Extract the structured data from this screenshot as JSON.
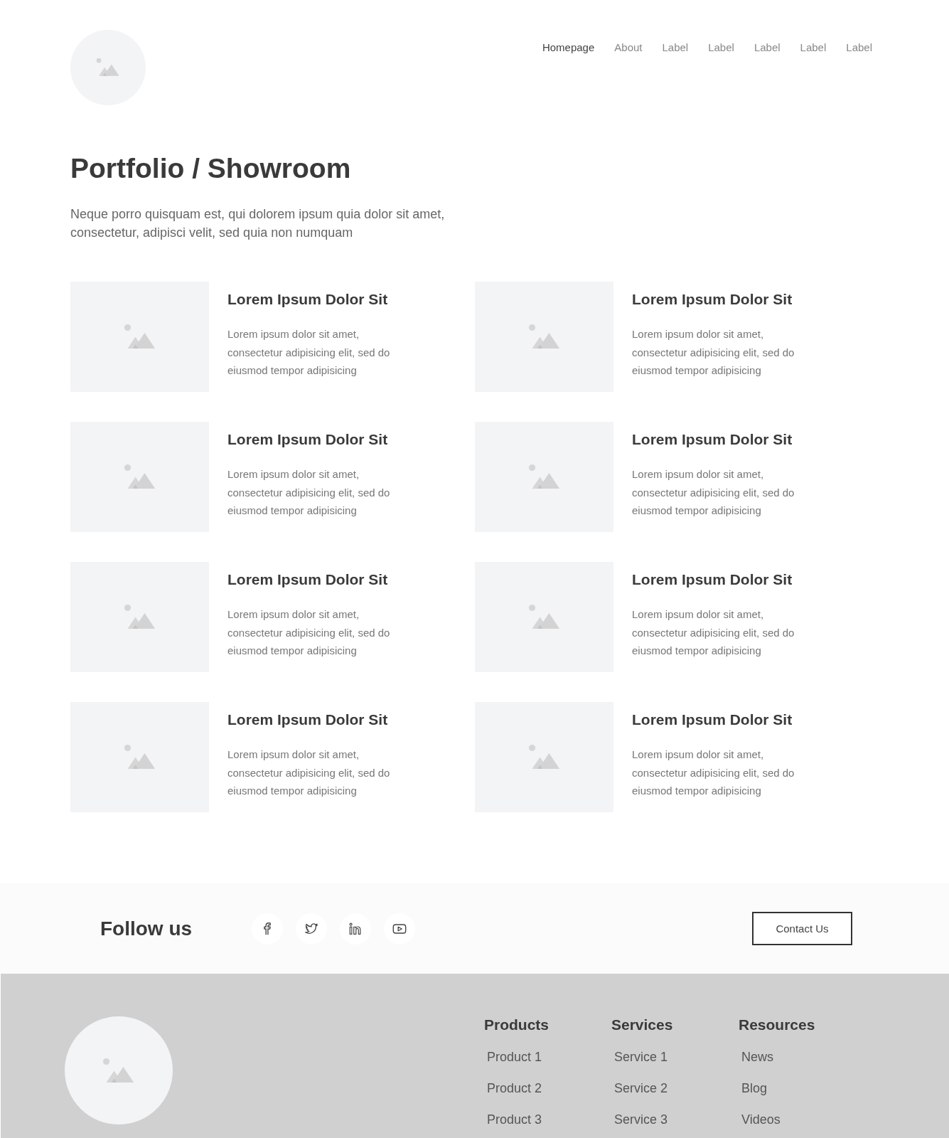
{
  "nav": [
    {
      "label": "Homepage",
      "selected": true
    },
    {
      "label": "About",
      "selected": false
    },
    {
      "label": "Label",
      "selected": false
    },
    {
      "label": "Label",
      "selected": false
    },
    {
      "label": "Label",
      "selected": false
    },
    {
      "label": "Label",
      "selected": false
    },
    {
      "label": "Label",
      "selected": false
    }
  ],
  "title": "Portfolio / Showroom",
  "intro": "Neque porro quisquam est, qui dolorem ipsum quia dolor sit amet, consectetur, adipisci velit, sed quia non numquam",
  "cards": [
    {
      "title": "Lorem Ipsum Dolor Sit",
      "text": "Lorem ipsum dolor sit amet, consectetur adipisicing elit, sed do eiusmod tempor adipisicing"
    },
    {
      "title": "Lorem Ipsum Dolor Sit",
      "text": "Lorem ipsum dolor sit amet, consectetur adipisicing elit, sed do eiusmod tempor adipisicing"
    },
    {
      "title": "Lorem Ipsum Dolor Sit",
      "text": "Lorem ipsum dolor sit amet, consectetur adipisicing elit, sed do eiusmod tempor adipisicing"
    },
    {
      "title": "Lorem Ipsum Dolor Sit",
      "text": "Lorem ipsum dolor sit amet, consectetur adipisicing elit, sed do eiusmod tempor adipisicing"
    },
    {
      "title": "Lorem Ipsum Dolor Sit",
      "text": "Lorem ipsum dolor sit amet, consectetur adipisicing elit, sed do eiusmod tempor adipisicing"
    },
    {
      "title": "Lorem Ipsum Dolor Sit",
      "text": "Lorem ipsum dolor sit amet, consectetur adipisicing elit, sed do eiusmod tempor adipisicing"
    },
    {
      "title": "Lorem Ipsum Dolor Sit",
      "text": "Lorem ipsum dolor sit amet, consectetur adipisicing elit, sed do eiusmod tempor adipisicing"
    },
    {
      "title": "Lorem Ipsum Dolor Sit",
      "text": "Lorem ipsum dolor sit amet, consectetur adipisicing elit, sed do eiusmod tempor adipisicing"
    }
  ],
  "follow": {
    "label": "Follow us",
    "socials": [
      {
        "kind": "facebook"
      },
      {
        "kind": "twitter"
      },
      {
        "kind": "linkedin"
      },
      {
        "kind": "youtube"
      }
    ],
    "button": "Contact Us"
  },
  "footer": {
    "columns": [
      {
        "heading": "Products",
        "links": [
          "Product 1",
          "Product 2",
          "Product 3"
        ]
      },
      {
        "heading": "Services",
        "links": [
          "Service 1",
          "Service 2",
          "Service 3"
        ]
      },
      {
        "heading": "Resources",
        "links": [
          "News",
          "Blog",
          "Videos"
        ]
      }
    ]
  }
}
